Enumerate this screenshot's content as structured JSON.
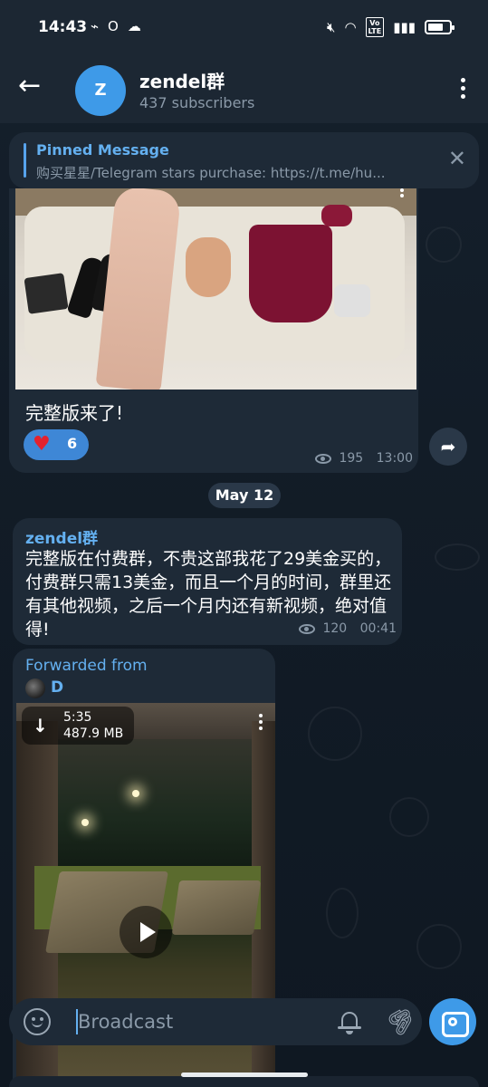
{
  "status_bar": {
    "time": "14:43",
    "left_icons": [
      "nfc-icon",
      "opera-icon",
      "cloud-icon"
    ],
    "right_icons": [
      "mute-icon",
      "wifi-icon",
      "volte-icon",
      "signal-icon",
      "battery-icon"
    ],
    "volte_label": "Vo\nLTE"
  },
  "header": {
    "avatar_letter": "Z",
    "channel_name": "zendel群",
    "subscribers": "437 subscribers"
  },
  "pinned": {
    "title": "Pinned Message",
    "text": "购买星星/Telegram stars purchase: https://t.me/hu..."
  },
  "photo_post": {
    "caption": "完整版来了!",
    "reaction_emoji": "♥",
    "reaction_count": "6",
    "views": "195",
    "time": "13:00"
  },
  "date_separator": "May 12",
  "text_post": {
    "author": "zendel群",
    "body": "完整版在付费群，不贵这部我花了29美金买的，付费群只需13美金，而且一个月的时间，群里还有其他视频，之后一个月内还有新视频，绝对值得!",
    "views": "120",
    "time": "00:41"
  },
  "video_post": {
    "forwarded_label": "Forwarded from",
    "forwarded_name": "D",
    "duration": "5:35",
    "size": "487.9 MB"
  },
  "input": {
    "placeholder": "Broadcast"
  },
  "colors": {
    "accent": "#3e9ae8",
    "link": "#64b0f0",
    "bubble": "#1e2a37",
    "header": "#1c2733"
  }
}
